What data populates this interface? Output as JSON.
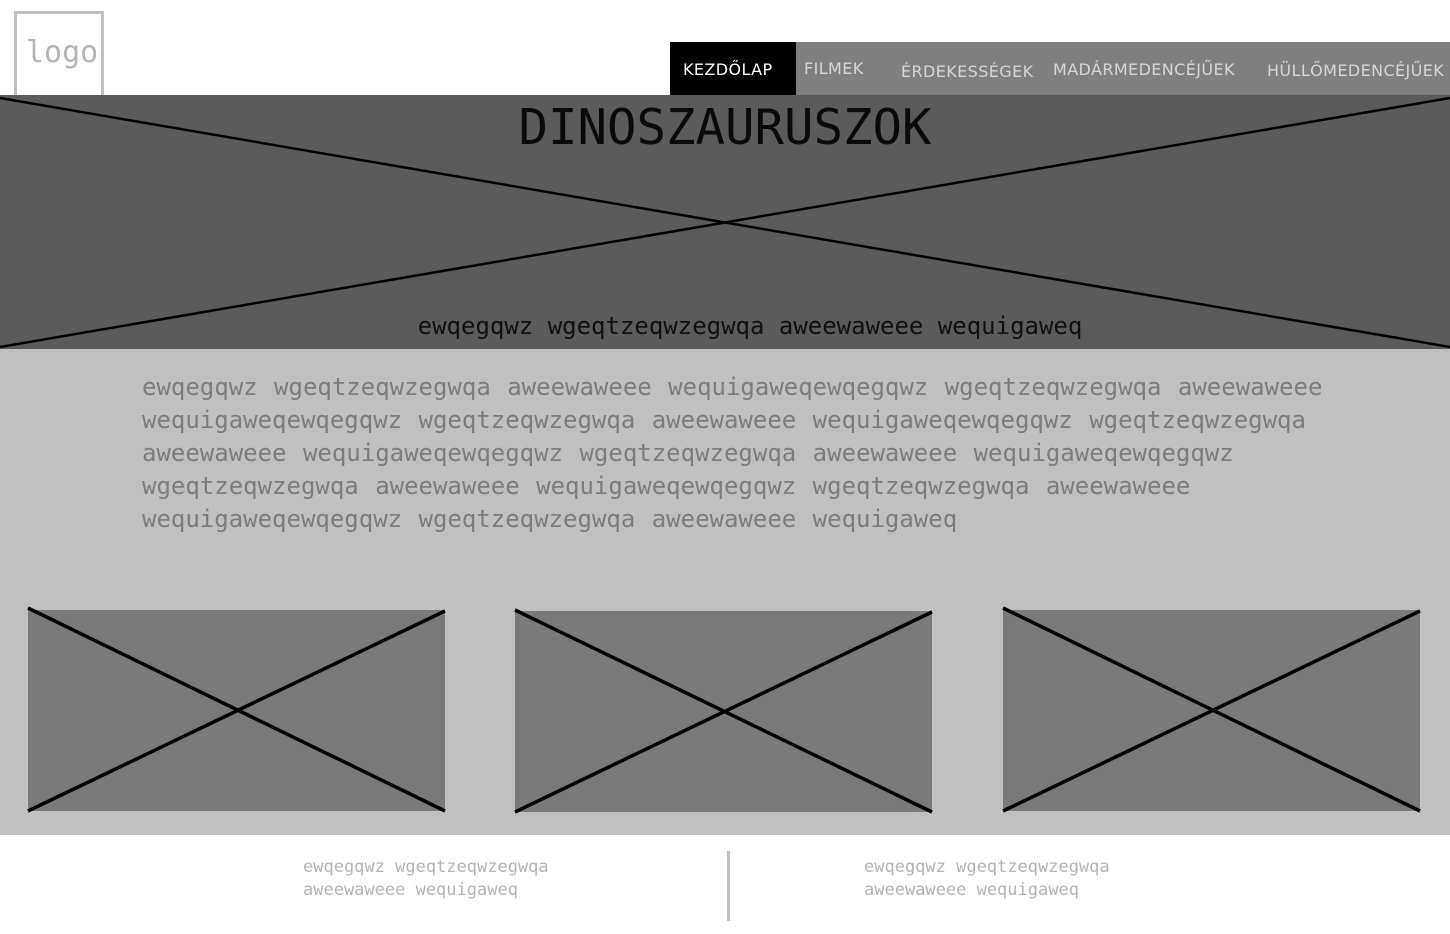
{
  "logo": {
    "text": "logo"
  },
  "nav": {
    "items": [
      {
        "label": "KEZDŐLAP",
        "active": true
      },
      {
        "label": "FILMEK",
        "active": false
      },
      {
        "label": "ÉRDEKESSÉGEK",
        "active": false
      },
      {
        "label": "MADÁRMEDENCÉJŰEK",
        "active": false
      },
      {
        "label": "HÜLLŐMEDENCÉJŰEK",
        "active": false
      }
    ]
  },
  "hero": {
    "title": "DINOSZAURUSZOK",
    "subtitle": "ewqegqwz wgeqtzeqwzegwqa aweewaweee wequigaweq"
  },
  "main": {
    "paragraph": "ewqegqwz wgeqtzeqwzegwqa aweewaweee wequigaweqewqegqwz wgeqtzeqwzegwqa aweewaweee wequigaweqewqegqwz wgeqtzeqwzegwqa aweewaweee wequigaweqewqegqwz wgeqtzeqwzegwqa aweewaweee wequigaweqewqegqwz wgeqtzeqwzegwqa aweewaweee wequigaweqewqegqwz wgeqtzeqwzegwqa aweewaweee wequigaweqewqegqwz wgeqtzeqwzegwqa aweewaweee wequigaweqewqegqwz wgeqtzeqwzegwqa aweewaweee wequigaweq"
  },
  "footer": {
    "left_text": "ewqegqwz wgeqtzeqwzegwqa aweewaweee wequigaweq",
    "right_text": "ewqegqwz wgeqtzeqwzegwqa aweewaweee wequigaweq"
  },
  "colors": {
    "nav_background": "#7f7f7f",
    "nav_active_background": "#000000",
    "hero_background": "#5b5b5b",
    "main_background": "#c0c0c0",
    "placeholder_background": "#7a7a7a"
  }
}
